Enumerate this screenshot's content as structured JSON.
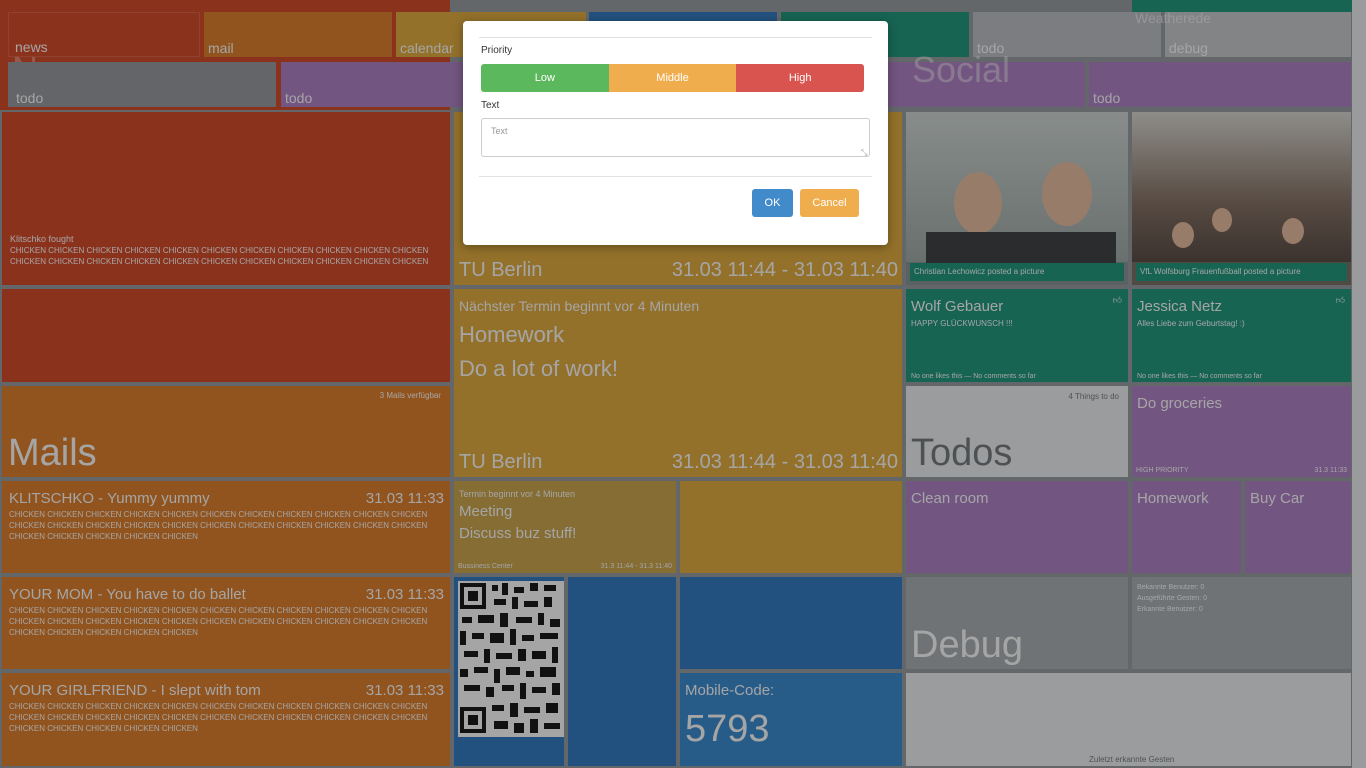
{
  "nav": {
    "news": "news",
    "mail": "mail",
    "calendar": "calendar",
    "todo1": "todo",
    "debug": "debug",
    "todo2": "todo",
    "todo3": "todo",
    "todo4": "todo",
    "bg_news": "News",
    "bg_social": "Social",
    "weather": "Weatherede"
  },
  "news": {
    "headline": "Klitschko fought",
    "body": "CHICKEN CHICKEN CHICKEN CHICKEN CHICKEN CHICKEN CHICKEN CHICKEN CHICKEN CHICKEN CHICKEN CHICKEN CHICKEN CHICKEN CHICKEN CHICKEN CHICKEN CHICKEN CHICKEN CHICKEN CHICKEN CHICKEN"
  },
  "mails": {
    "count": "3 Mails verfügbar",
    "title": "Mails",
    "items": [
      {
        "title": "KLITSCHKO - Yummy yummy",
        "time": "31.03 11:33",
        "body": "CHICKEN CHICKEN CHICKEN CHICKEN CHICKEN CHICKEN CHICKEN CHICKEN CHICKEN CHICKEN CHICKEN CHICKEN CHICKEN CHICKEN CHICKEN CHICKEN CHICKEN CHICKEN CHICKEN CHICKEN CHICKEN CHICKEN CHICKEN CHICKEN CHICKEN CHICKEN CHICKEN"
      },
      {
        "title": "YOUR MOM - You have to do ballet",
        "time": "31.03 11:33",
        "body": "CHICKEN CHICKEN CHICKEN CHICKEN CHICKEN CHICKEN CHICKEN CHICKEN CHICKEN CHICKEN CHICKEN CHICKEN CHICKEN CHICKEN CHICKEN CHICKEN CHICKEN CHICKEN CHICKEN CHICKEN CHICKEN CHICKEN CHICKEN CHICKEN CHICKEN CHICKEN CHICKEN"
      },
      {
        "title": "YOUR GIRLFRIEND - I slept with tom",
        "time": "31.03 11:33",
        "body": "CHICKEN CHICKEN CHICKEN CHICKEN CHICKEN CHICKEN CHICKEN CHICKEN CHICKEN CHICKEN CHICKEN CHICKEN CHICKEN CHICKEN CHICKEN CHICKEN CHICKEN CHICKEN CHICKEN CHICKEN CHICKEN CHICKEN CHICKEN CHICKEN CHICKEN CHICKEN CHICKEN"
      }
    ]
  },
  "calendar": {
    "top": {
      "location": "TU Berlin",
      "time": "31.03 11:44 - 31.03 11:40"
    },
    "main": {
      "note": "Nächster Termin beginnt vor 4 Minuten",
      "title": "Homework",
      "desc": "Do a lot of work!",
      "location": "TU Berlin",
      "time": "31.03 11:44 - 31.03 11:40"
    },
    "small": {
      "note": "Termin beginnt vor 4 Minuten",
      "title": "Meeting",
      "desc": "Discuss buz stuff!",
      "location": "Bussiness Center",
      "time": "31.3 11:44 - 31.3 11:40"
    }
  },
  "mobile": {
    "label": "Mobile-Code:",
    "code": "5793"
  },
  "social": {
    "photo1_caption": "Christian Lechowicz posted a picture",
    "photo2_caption": "VfL Wolfsburg Frauenfußball posted a picture",
    "post1": {
      "name": "Wolf Gebauer",
      "text": "HAPPY GLÜCKWUNSCH !!!",
      "meta": "No one likes this — No comments so far"
    },
    "post2": {
      "name": "Jessica Netz",
      "text": "Alles Liebe zum Geburtstag! :)",
      "meta": "No one likes this — No comments so far"
    }
  },
  "todos": {
    "count": "4 Things to do",
    "title": "Todos",
    "first": {
      "title": "Do groceries",
      "priority": "HIGH PRIORITY",
      "date": "31.3 11:33"
    },
    "items": [
      "Clean room",
      "Homework",
      "Buy Car"
    ]
  },
  "debug": {
    "title": "Debug",
    "stats": [
      "Bekannte Benutzer: 0",
      "Ausgeführte Gesten: 0",
      "Erkannte Benutzer: 0"
    ],
    "footer": "Zuletzt erkannte Gesten"
  },
  "modal": {
    "priority_label": "Priority",
    "low": "Low",
    "middle": "Middle",
    "high": "High",
    "text_label": "Text",
    "text_placeholder": "Text",
    "ok": "OK",
    "cancel": "Cancel"
  },
  "colors": {
    "news": "#d23a16",
    "mail": "#dd7417",
    "calendar": "#e1a52c",
    "mobile": "#1f6fbd",
    "social": "#0b8f72",
    "todo": "#a875c2",
    "priority_low": "#5cb85c",
    "priority_mid": "#f0ad4e",
    "priority_high": "#d9534f",
    "ok": "#428bca"
  }
}
